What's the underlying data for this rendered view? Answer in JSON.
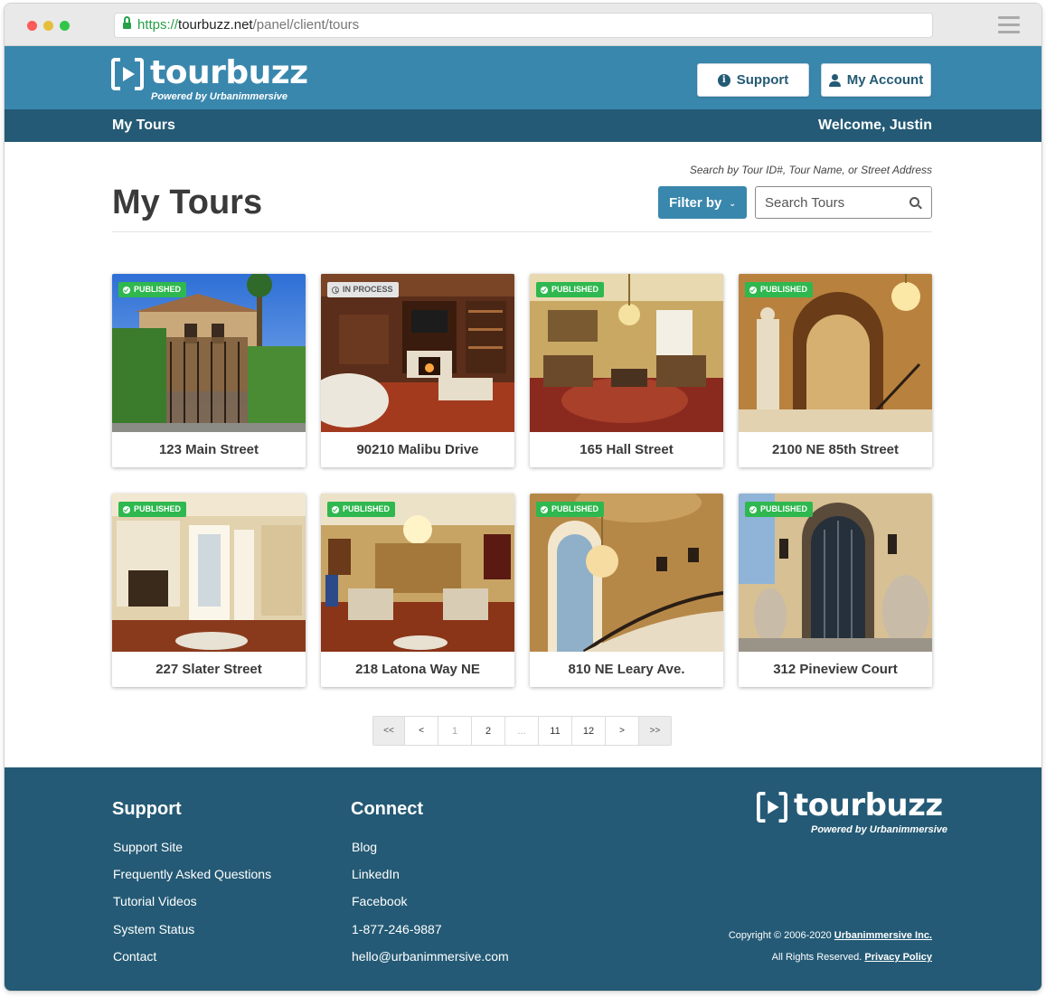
{
  "browser": {
    "url_scheme": "https://",
    "url_host": "tourbuzz.net",
    "url_path": "/panel/client/tours"
  },
  "header": {
    "logo_text": "tourbuzz",
    "logo_sub": "Powered by Urbanimmersive",
    "support_label": "Support",
    "account_label": "My Account",
    "nav_title": "My Tours",
    "welcome": "Welcome, Justin"
  },
  "main": {
    "title": "My Tours",
    "search_hint": "Search by Tour ID#, Tour Name, or Street Address",
    "filter_label": "Filter by",
    "search_placeholder": "Search Tours",
    "tours": [
      {
        "name": "123 Main Street",
        "status": "PUBLISHED"
      },
      {
        "name": "90210 Malibu Drive",
        "status": "IN PROCESS"
      },
      {
        "name": "165 Hall Street",
        "status": "PUBLISHED"
      },
      {
        "name": "2100 NE 85th Street",
        "status": "PUBLISHED"
      },
      {
        "name": "227 Slater Street",
        "status": "PUBLISHED"
      },
      {
        "name": "218 Latona Way NE",
        "status": "PUBLISHED"
      },
      {
        "name": "810 NE Leary Ave.",
        "status": "PUBLISHED"
      },
      {
        "name": "312 Pineview Court",
        "status": "PUBLISHED"
      }
    ],
    "pagination": [
      "<<",
      "<",
      "1",
      "2",
      "...",
      "11",
      "12",
      ">",
      ">>"
    ]
  },
  "footer": {
    "support_title": "Support",
    "support_links": [
      "Support Site",
      "Frequently Asked Questions",
      "Tutorial Videos",
      "System Status",
      "Contact"
    ],
    "connect_title": "Connect",
    "connect_links": [
      "Blog",
      "LinkedIn",
      "Facebook",
      "1-877-246-9887",
      "hello@urbanimmersive.com"
    ],
    "copyright_prefix": "Copyright © 2006-2020",
    "copyright_company": "Urbanimmersive Inc.",
    "rights": "All Rights Reserved.",
    "privacy": "Privacy Policy"
  },
  "colors": {
    "brand_blue": "#3a87ad",
    "brand_dark": "#245a75",
    "published_green": "#2fb84f"
  }
}
